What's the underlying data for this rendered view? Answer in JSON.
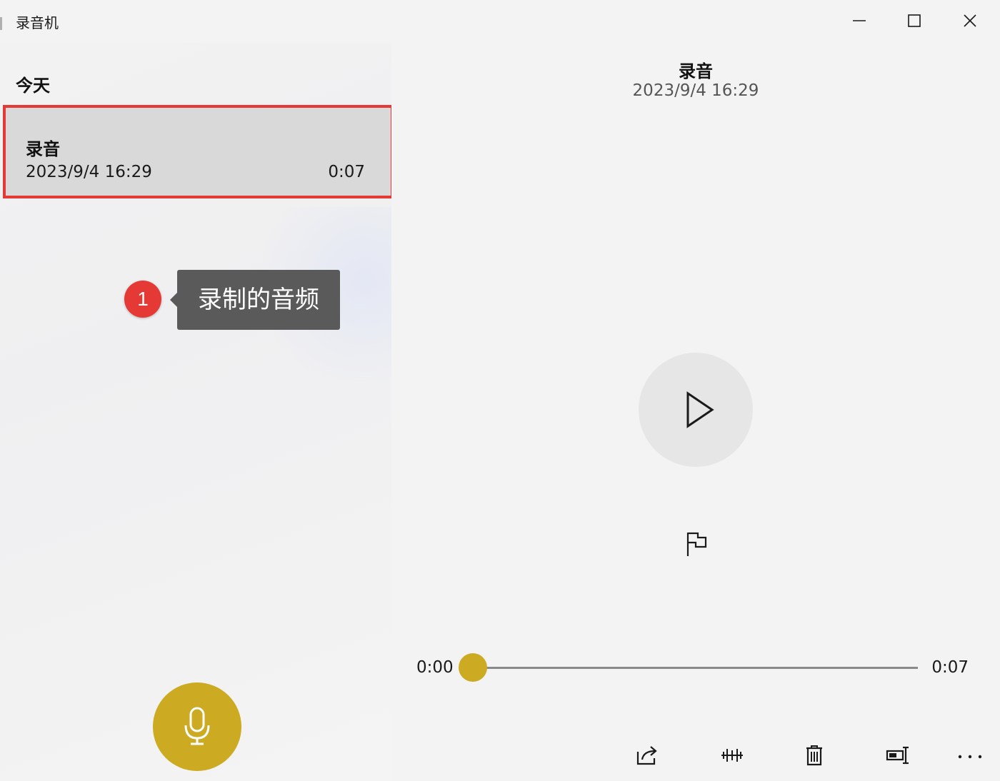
{
  "window": {
    "title": "录音机"
  },
  "list": {
    "section_header": "今天",
    "items": [
      {
        "name": "录音",
        "date": "2023/9/4 16:29",
        "duration": "0:07"
      }
    ]
  },
  "annotation": {
    "number": "1",
    "text": "录制的音频"
  },
  "detail": {
    "title": "录音",
    "date": "2023/9/4 16:29",
    "time_current": "0:00",
    "time_total": "0:07",
    "progress": 0
  },
  "icons": {
    "minimize": "minimize-icon",
    "maximize": "maximize-icon",
    "close": "close-icon",
    "record": "microphone-icon",
    "play": "play-icon",
    "marker": "flag-icon",
    "share": "share-icon",
    "trim": "trim-icon",
    "delete": "trash-icon",
    "rename": "rename-icon",
    "more": "more-icon"
  },
  "colors": {
    "accent": "#ccaa22",
    "highlight_border": "#e53935",
    "callout_bg": "#5a5a5a",
    "selected_bg": "#d9d9d9",
    "window_bg": "#f3f3f3"
  }
}
